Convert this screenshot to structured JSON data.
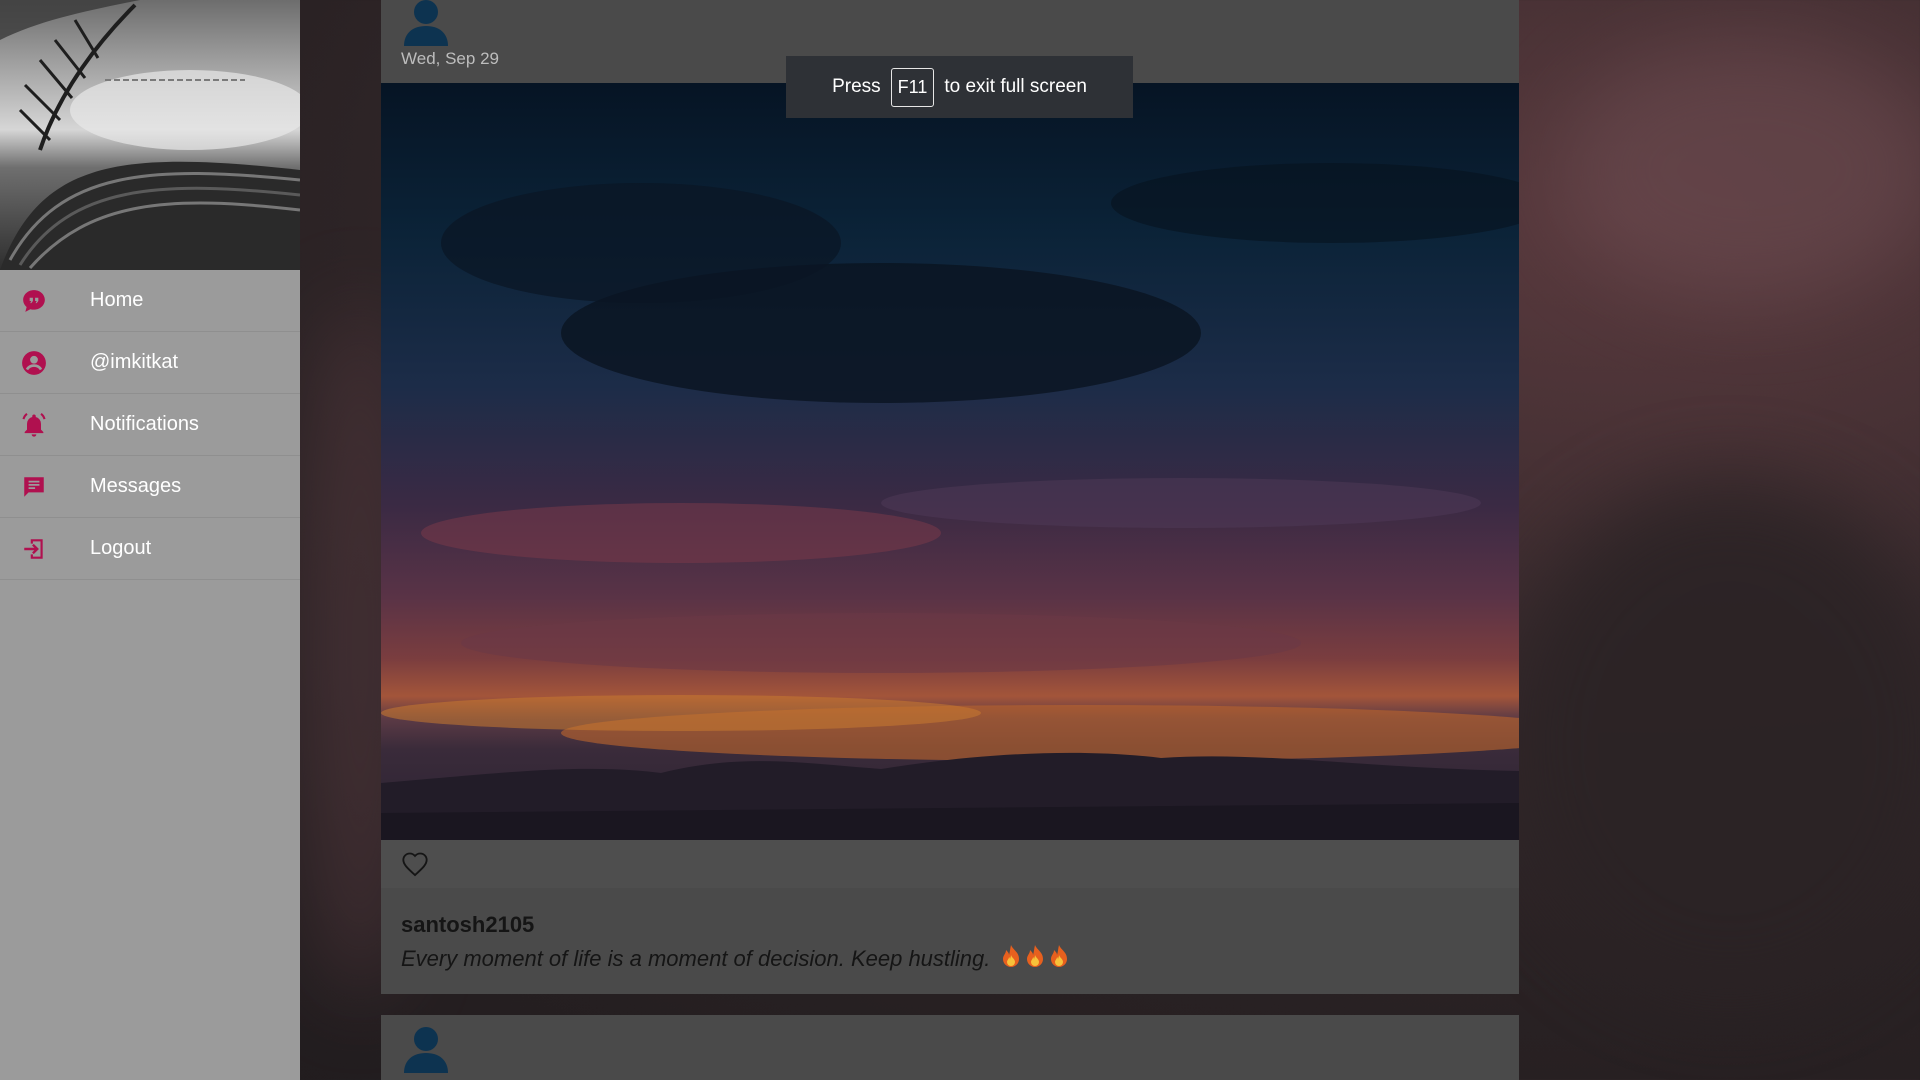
{
  "sidebar": {
    "items": [
      {
        "label": "Home",
        "icon": "chat-bubble-icon"
      },
      {
        "label": "@imkitkat",
        "icon": "account-icon"
      },
      {
        "label": "Notifications",
        "icon": "bell-icon"
      },
      {
        "label": "Messages",
        "icon": "message-icon"
      },
      {
        "label": "Logout",
        "icon": "logout-icon"
      }
    ],
    "accent_color": "#b0104f"
  },
  "posts": [
    {
      "date": "Wed, Sep 29",
      "author": "santosh2105",
      "caption": "Every moment of life is a moment of decision. Keep hustling.",
      "emojis": "🔥🔥🔥"
    }
  ],
  "fullscreen_toast": {
    "prefix": "Press",
    "key": "F11",
    "suffix": "to exit full screen"
  }
}
